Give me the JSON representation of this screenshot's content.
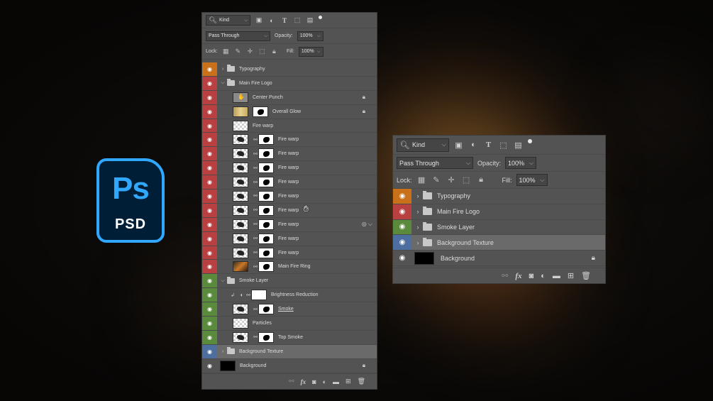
{
  "logo": {
    "letters": "Ps",
    "sub": "PSD"
  },
  "panel_large": {
    "search_kind": "Kind",
    "blend_mode": "Pass Through",
    "opacity_label": "Opacity:",
    "opacity_value": "100%",
    "lock_label": "Lock:",
    "fill_label": "Fill:",
    "fill_value": "100%",
    "layers": [
      {
        "name": "Typography",
        "color": "orange",
        "type": "group",
        "expanded": false
      },
      {
        "name": "Main Fire Logo",
        "color": "red",
        "type": "group",
        "expanded": true
      },
      {
        "name": "Center Punch",
        "color": "red",
        "type": "layer",
        "locked": true
      },
      {
        "name": "Overall Glow",
        "color": "red",
        "type": "layer",
        "locked": true
      },
      {
        "name": "Fire warp",
        "color": "red",
        "type": "layer"
      },
      {
        "name": "Fire warp",
        "color": "red",
        "type": "layer"
      },
      {
        "name": "Fire warp",
        "color": "red",
        "type": "layer"
      },
      {
        "name": "Fire warp",
        "color": "red",
        "type": "layer"
      },
      {
        "name": "Fire warp",
        "color": "red",
        "type": "layer"
      },
      {
        "name": "Fire warp",
        "color": "red",
        "type": "layer"
      },
      {
        "name": "Fire warp",
        "color": "red",
        "type": "layer"
      },
      {
        "name": "Fire warp",
        "color": "red",
        "type": "layer"
      },
      {
        "name": "Fire warp",
        "color": "red",
        "type": "layer"
      },
      {
        "name": "Fire warp",
        "color": "red",
        "type": "layer"
      },
      {
        "name": "Main Fire Ring",
        "color": "red",
        "type": "layer"
      },
      {
        "name": "Smoke Layer",
        "color": "green",
        "type": "group",
        "expanded": true
      },
      {
        "name": "Brightness Reduction",
        "color": "green",
        "type": "adjustment"
      },
      {
        "name": "Smoke",
        "color": "green",
        "type": "layer"
      },
      {
        "name": "Particles",
        "color": "green",
        "type": "layer"
      },
      {
        "name": "Top Smoke",
        "color": "green",
        "type": "layer"
      },
      {
        "name": "Background Texture",
        "color": "blue",
        "type": "group",
        "expanded": false,
        "selected": true
      },
      {
        "name": "Background",
        "color": "none",
        "type": "layer",
        "locked": true
      }
    ]
  },
  "panel_small": {
    "search_kind": "Kind",
    "blend_mode": "Pass Through",
    "opacity_label": "Opacity:",
    "opacity_value": "100%",
    "lock_label": "Lock:",
    "fill_label": "Fill:",
    "fill_value": "100%",
    "layers": [
      {
        "name": "Typography",
        "color": "orange",
        "type": "group"
      },
      {
        "name": "Main Fire Logo",
        "color": "red",
        "type": "group"
      },
      {
        "name": "Smoke Layer",
        "color": "green",
        "type": "group"
      },
      {
        "name": "Background Texture",
        "color": "blue",
        "type": "group",
        "selected": true
      },
      {
        "name": "Background",
        "color": "none",
        "type": "layer",
        "locked": true
      }
    ]
  },
  "colors": {
    "orange": "#c9701a",
    "red": "#b84040",
    "green": "#5a8a3c",
    "blue": "#4c6f9f",
    "panel": "#535353",
    "ps_blue": "#31a8ff",
    "ps_dark": "#001e36"
  },
  "icons": {
    "search": "search-icon",
    "eye": "eye-icon",
    "folder": "folder-icon",
    "lock": "lock-icon",
    "link": "link-icon",
    "fx": "fx-icon",
    "trash": "trash-icon"
  }
}
